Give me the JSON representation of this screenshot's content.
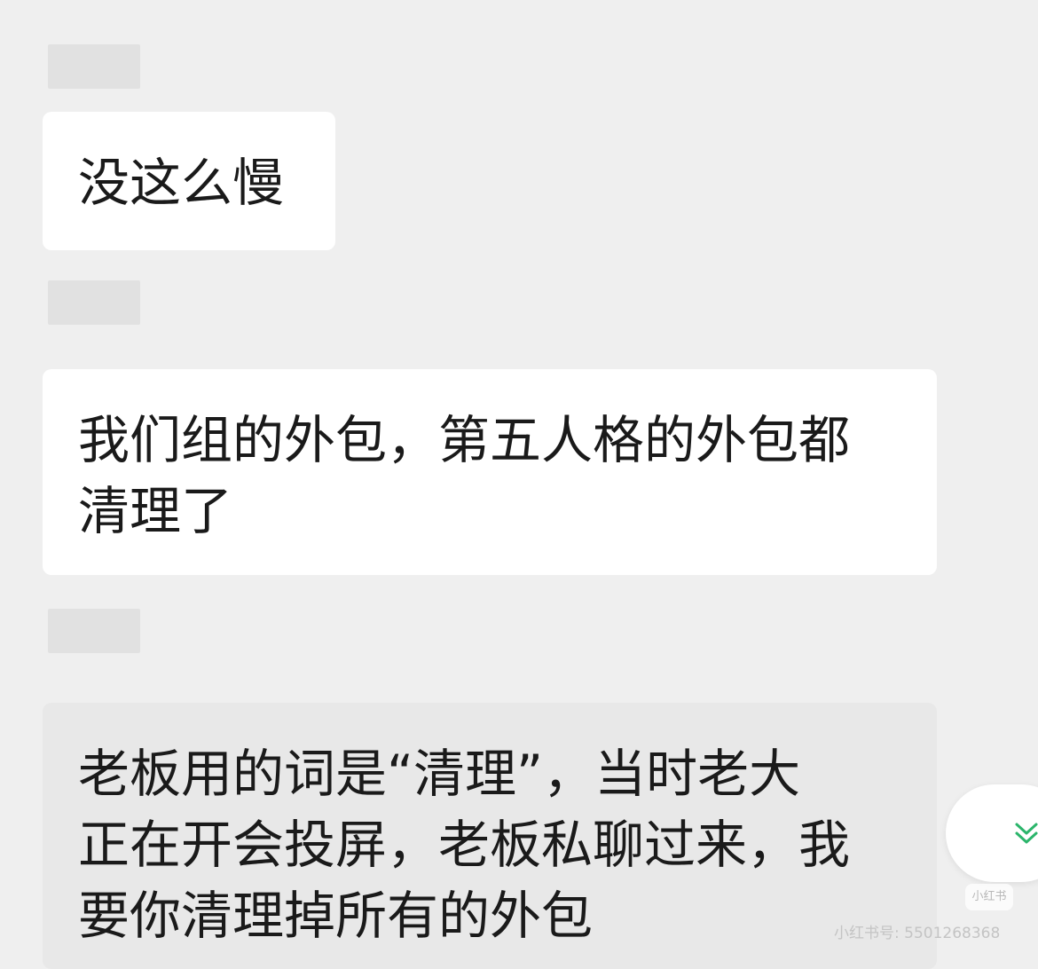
{
  "messages": [
    {
      "sender_name": "",
      "text": "没这么慢"
    },
    {
      "sender_name": "",
      "text": "我们组的外包，第五人格的外包都\n清理了"
    },
    {
      "sender_name": "",
      "text": "老板用的词是“清理”，当时老大\n正在开会投屏，老板私聊过来，我\n要你清理掉所有的外包"
    }
  ],
  "scroll_button": {
    "icon": "double-chevron-down-icon"
  },
  "watermark": {
    "logo_text": "小红书",
    "id_text": "小红书号: 5501268368"
  },
  "colors": {
    "background": "#efefef",
    "bubble": "#ffffff",
    "pressed_bubble": "#e8e8e8",
    "accent": "#2bb56b"
  }
}
